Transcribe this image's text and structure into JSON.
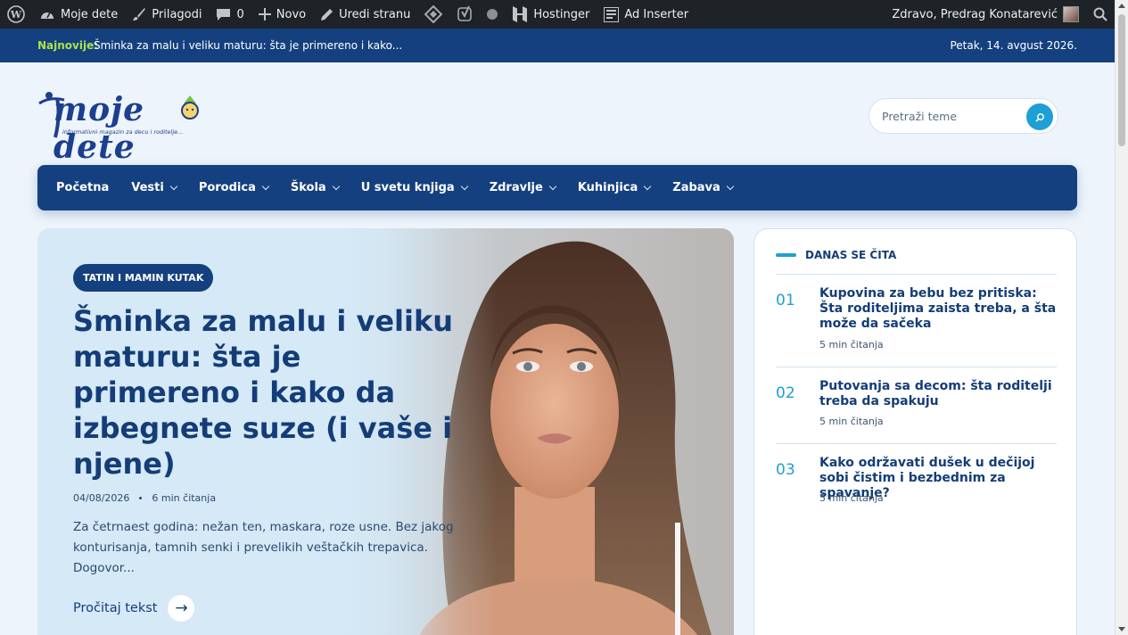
{
  "admin_bar": {
    "site_name": "Moje dete",
    "customize": "Prilagodi",
    "comments_count": "0",
    "new": "Novo",
    "edit_page": "Uredi stranu",
    "hostinger": "Hostinger",
    "ad_inserter": "Ad Inserter",
    "greeting": "Zdravo, Predrag Konatarević"
  },
  "ticker": {
    "label": "Najnovije:",
    "headline": "Šminka za malu i veliku maturu: šta je primereno i kako...",
    "date": "Petak, 14. avgust 2026."
  },
  "logo": {
    "name": "moje dete",
    "tagline": "informativni magazin za decu i roditelje..."
  },
  "search": {
    "placeholder": "Pretraži teme"
  },
  "nav": {
    "items": [
      {
        "label": "Početna"
      },
      {
        "label": "Vesti"
      },
      {
        "label": "Porodica"
      },
      {
        "label": "Škola"
      },
      {
        "label": "U svetu knjiga"
      },
      {
        "label": "Zdravlje"
      },
      {
        "label": "Kuhinjica"
      },
      {
        "label": "Zabava"
      }
    ]
  },
  "hero": {
    "category": "TATIN I MAMIN KUTAK",
    "title": "Šminka za malu i veliku maturu: šta je primereno i kako da izbegnete suze (i vaše i njene)",
    "date": "04/08/2026",
    "read_time": "6 min čitanja",
    "excerpt": "Za četrnaest godina: nežan ten, maskara, roze usne. Bez jakog konturisanja, tamnih senki i prevelikih veštačkih trepavica. Dogovor...",
    "read_more": "Pročitaj tekst",
    "arrow": "→"
  },
  "sidebar": {
    "heading": "DANAS SE ČITA",
    "items": [
      {
        "num": "01",
        "title": "Kupovina za bebu bez pritiska: Šta roditeljima zaista treba, a šta može da sačeka",
        "time": "5 min čitanja"
      },
      {
        "num": "02",
        "title": "Putovanja sa decom: šta roditelji treba da spakuju",
        "time": "5 min čitanja"
      },
      {
        "num": "03",
        "title": "Kako održavati dušek u dečijoj sobi čistim i bezbednim za spavanje?",
        "time": "5 min čitanja"
      }
    ]
  },
  "colors": {
    "primary": "#15407f",
    "accent": "#1e9fd6",
    "ticker_label": "#a7e34b",
    "admin_bar": "#1d2327"
  }
}
